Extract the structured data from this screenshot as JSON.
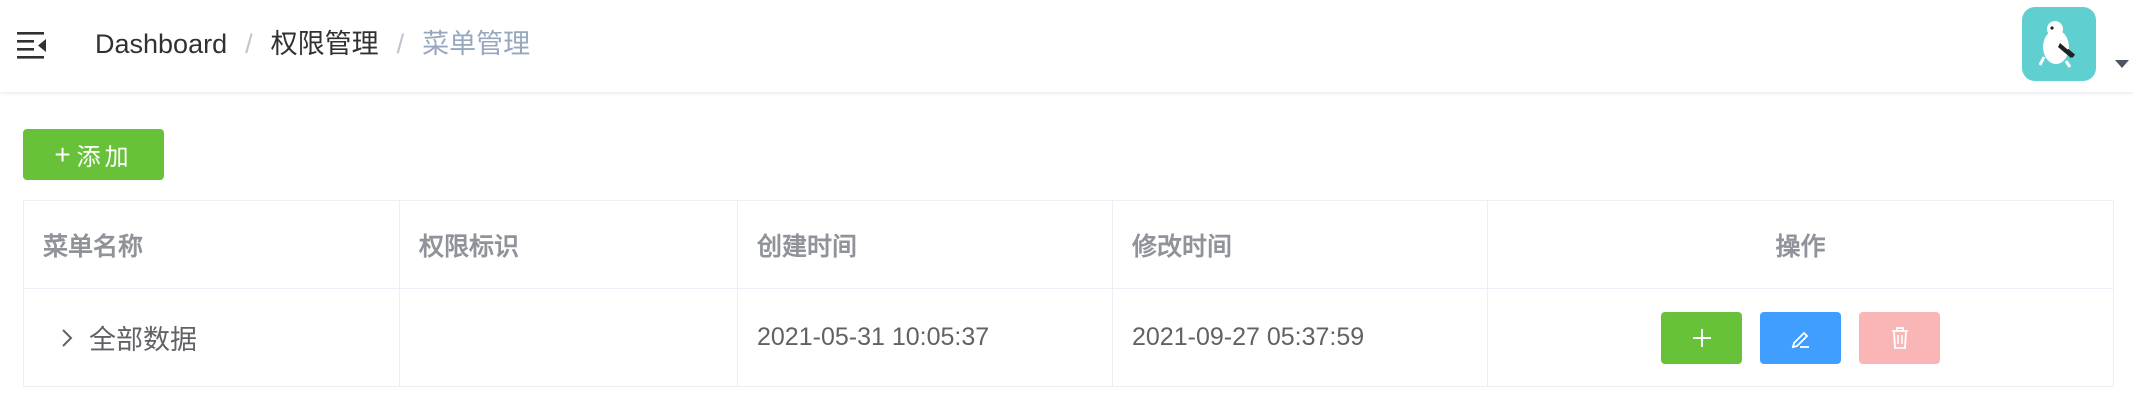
{
  "header": {
    "breadcrumb": [
      "Dashboard",
      "权限管理",
      "菜单管理"
    ],
    "separator": "/"
  },
  "toolbar": {
    "add_label": "添加",
    "add_icon": "plus-icon"
  },
  "table": {
    "columns": [
      "菜单名称",
      "权限标识",
      "创建时间",
      "修改时间",
      "操作"
    ],
    "rows": [
      {
        "name": "全部数据",
        "permission": "",
        "created": "2021-05-31 10:05:37",
        "modified": "2021-09-27 05:37:59"
      }
    ],
    "row_actions": [
      "plus-icon",
      "edit-icon",
      "delete-icon"
    ]
  },
  "colors": {
    "success": "#67c23a",
    "primary": "#409eff",
    "danger_disabled": "#fab6b6",
    "muted": "#97a8be"
  }
}
